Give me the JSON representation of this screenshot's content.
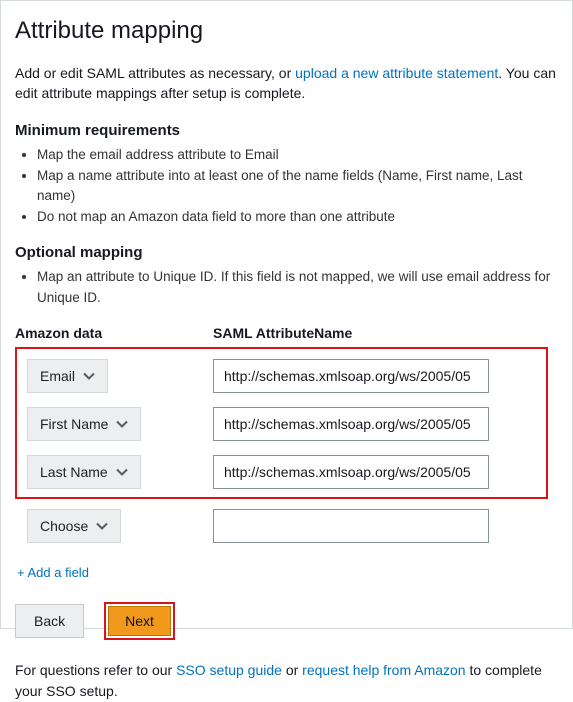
{
  "title": "Attribute mapping",
  "intro_pre": "Add or edit SAML attributes as necessary, or ",
  "intro_link": "upload a new attribute statement",
  "intro_post": ". You can edit attribute mappings after setup is complete.",
  "min_req_heading": "Minimum requirements",
  "min_req": [
    "Map the email address attribute to Email",
    "Map a name attribute into at least one of the name fields (Name, First name, Last name)",
    "Do not map an Amazon data field to more than one attribute"
  ],
  "opt_heading": "Optional mapping",
  "opt_items": [
    "Map an attribute to Unique ID. If this field is not mapped, we will use email address for Unique ID."
  ],
  "col_a": "Amazon data",
  "col_b": "SAML AttributeName",
  "rows": [
    {
      "label": "Email",
      "value": "http://schemas.xmlsoap.org/ws/2005/05"
    },
    {
      "label": "First Name",
      "value": "http://schemas.xmlsoap.org/ws/2005/05"
    },
    {
      "label": "Last Name",
      "value": "http://schemas.xmlsoap.org/ws/2005/05"
    }
  ],
  "choose_label": "Choose",
  "choose_value": "",
  "add_field": "+ Add a field",
  "back": "Back",
  "next": "Next",
  "footer_pre": "For questions refer to our ",
  "footer_link1": "SSO setup guide",
  "footer_mid": " or ",
  "footer_link2": "request help from Amazon",
  "footer_post": " to complete your SSO setup."
}
